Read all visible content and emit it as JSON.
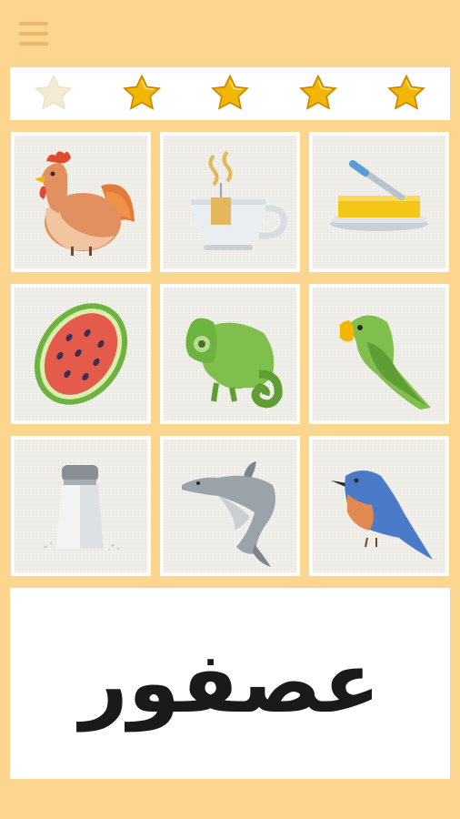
{
  "menu": {
    "icon": "hamburger-menu-icon"
  },
  "stars": [
    {
      "state": "empty",
      "icon": "star-icon"
    },
    {
      "state": "filled",
      "icon": "star-icon"
    },
    {
      "state": "filled",
      "icon": "star-icon"
    },
    {
      "state": "filled",
      "icon": "star-icon"
    },
    {
      "state": "filled",
      "icon": "star-icon"
    }
  ],
  "cards": [
    {
      "icon": "rooster-icon"
    },
    {
      "icon": "tea-cup-icon"
    },
    {
      "icon": "butter-icon"
    },
    {
      "icon": "watermelon-icon"
    },
    {
      "icon": "chameleon-icon"
    },
    {
      "icon": "parrot-icon"
    },
    {
      "icon": "salt-shaker-icon"
    },
    {
      "icon": "dolphin-icon"
    },
    {
      "icon": "bluebird-icon"
    }
  ],
  "word": {
    "text": "عصفور"
  },
  "colors": {
    "background": "#FCD58E",
    "star_filled": "#F2B705",
    "star_empty": "#F4EBD4"
  }
}
